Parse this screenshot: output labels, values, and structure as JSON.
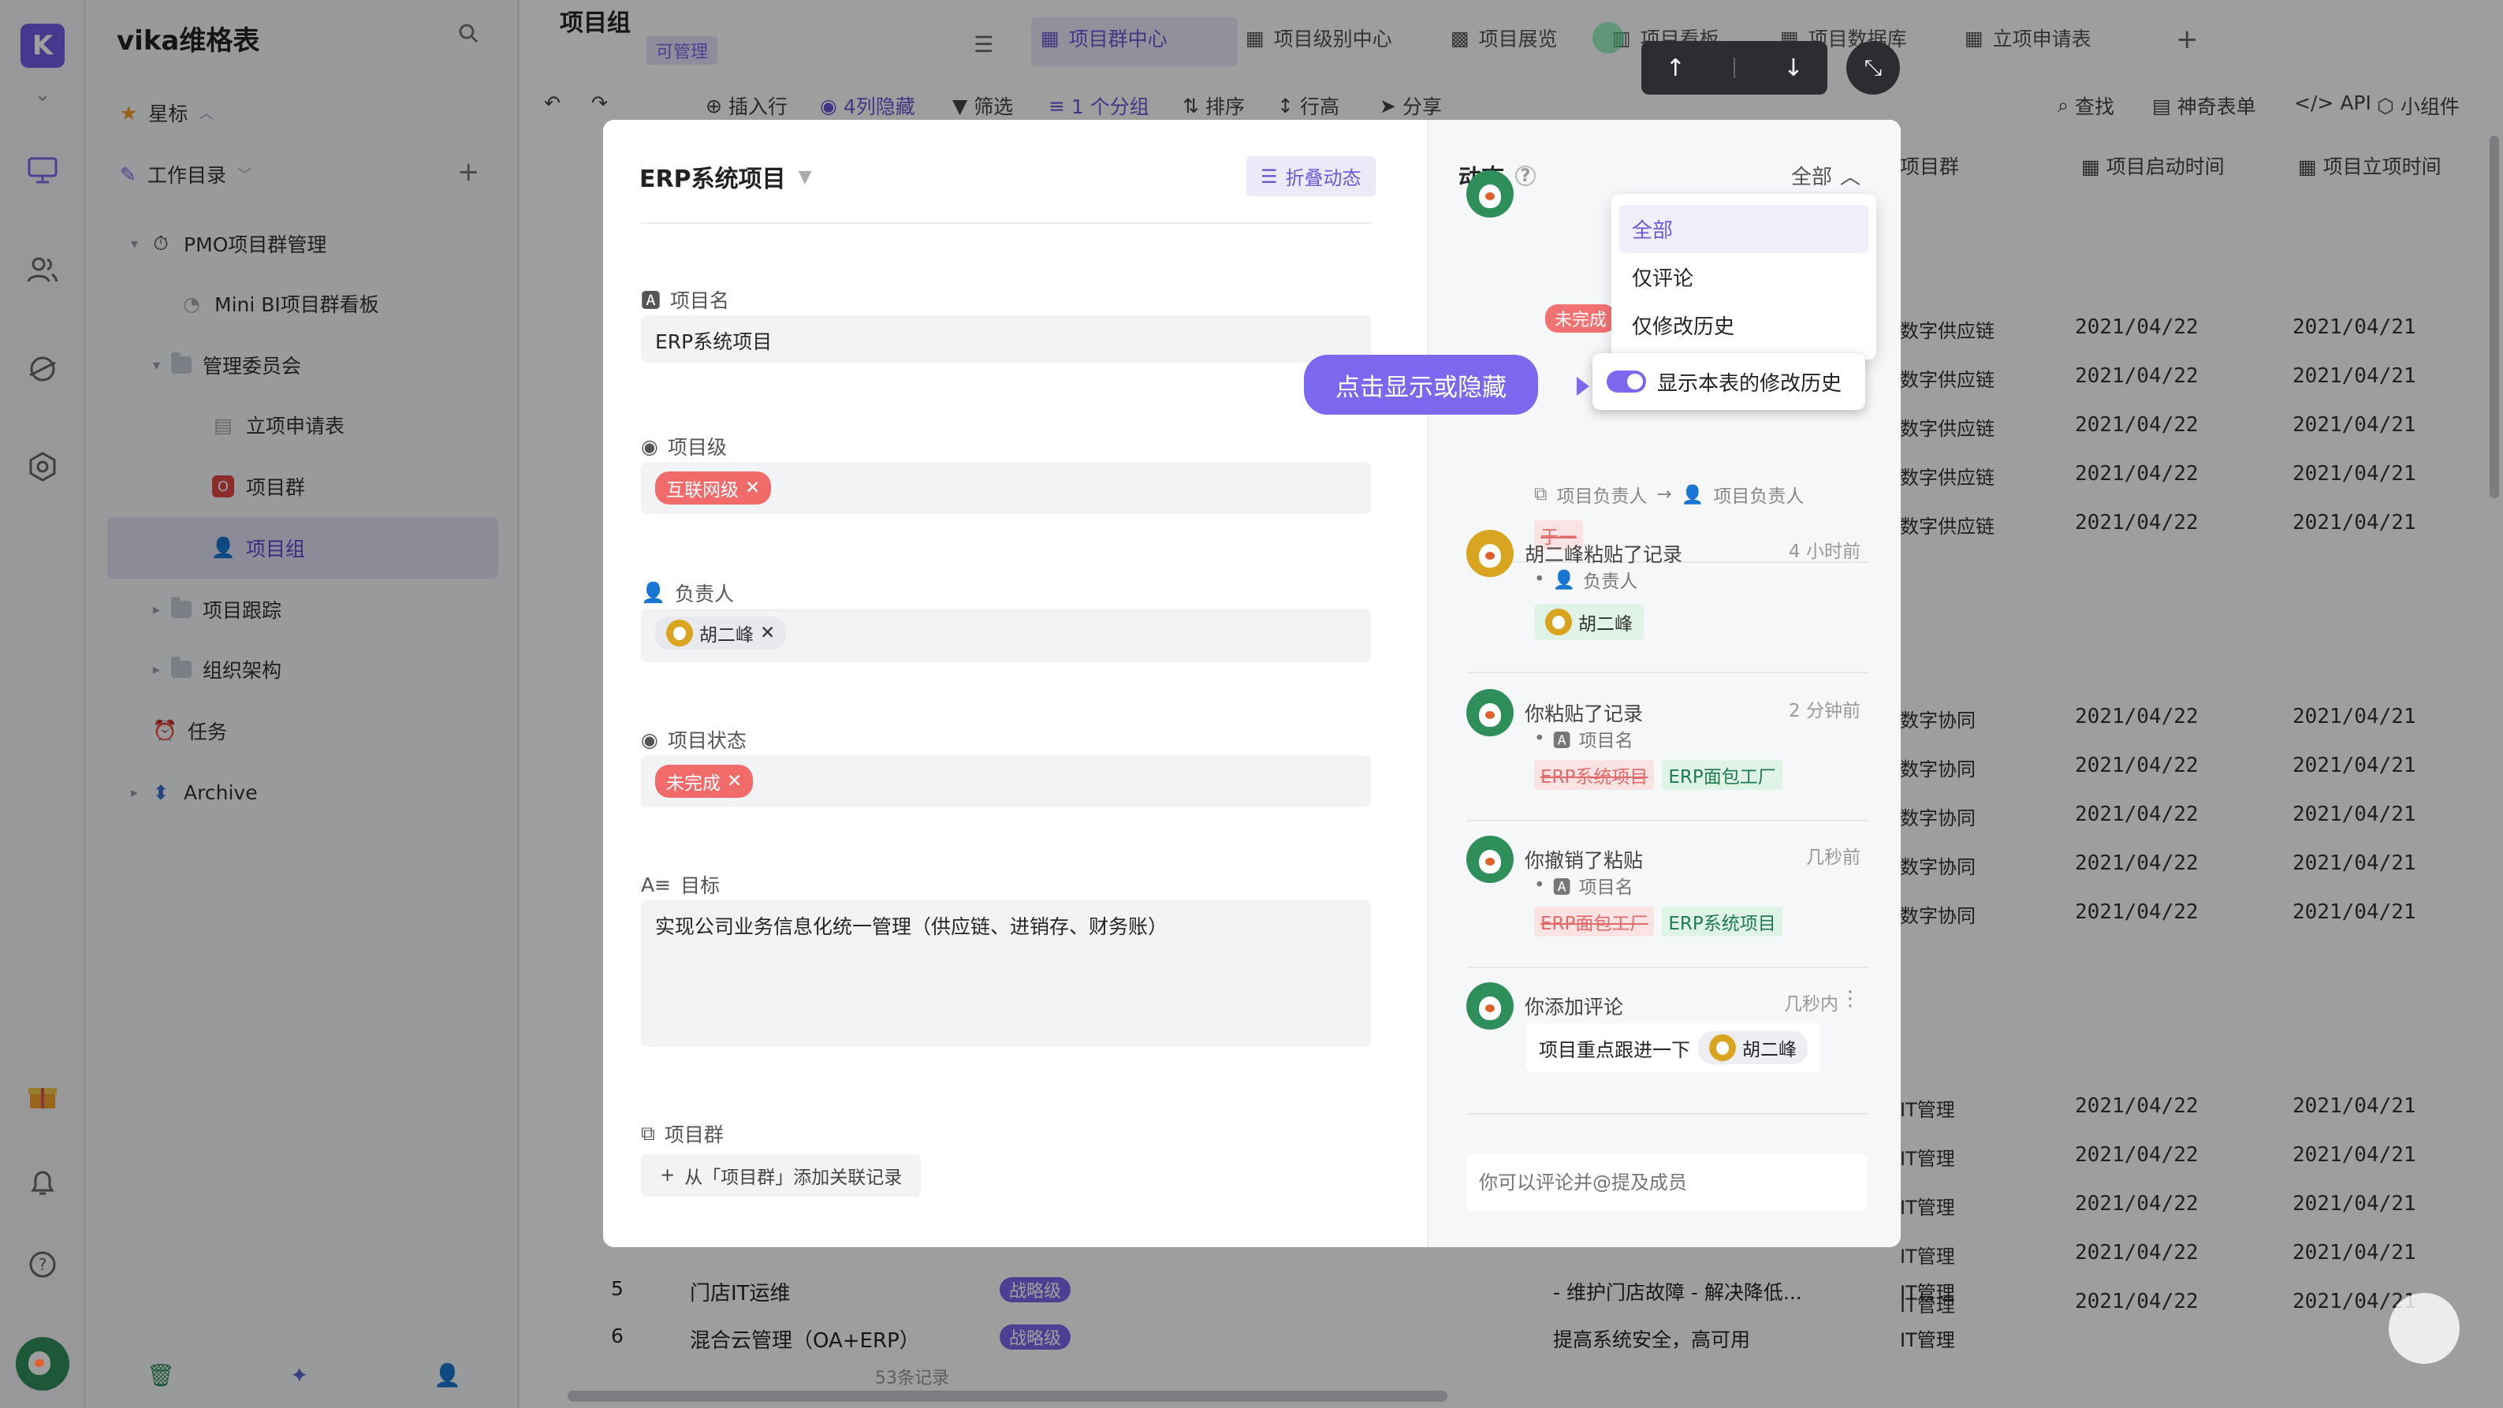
{
  "app": {
    "name": "vika维格表"
  },
  "sidebar": {
    "star_label": "星标",
    "workdir_label": "工作目录",
    "items": [
      {
        "label": "PMO项目群管理"
      },
      {
        "label": "Mini BI项目群看板"
      },
      {
        "label": "管理委员会"
      },
      {
        "label": "立项申请表"
      },
      {
        "label": "项目群"
      },
      {
        "label": "项目组"
      },
      {
        "label": "项目跟踪"
      },
      {
        "label": "组织架构"
      },
      {
        "label": "任务"
      },
      {
        "label": "Archive"
      }
    ]
  },
  "header": {
    "sheet_title": "项目组",
    "permission_badge": "可管理",
    "tabs": [
      {
        "label": "项目群中心"
      },
      {
        "label": "项目级别中心"
      },
      {
        "label": "项目展览"
      },
      {
        "label": "项目看板"
      },
      {
        "label": "项目数据库"
      },
      {
        "label": "立项申请表"
      }
    ]
  },
  "toolbar": {
    "insert_row": "插入行",
    "hidden_cols": "4列隐藏",
    "filter": "筛选",
    "group": "1 个分组",
    "sort": "排序",
    "row_height": "行高",
    "share": "分享",
    "find": "查找",
    "magic_form": "神奇表单",
    "api": "API",
    "widget": "小组件"
  },
  "grid": {
    "col_group": "项目群",
    "col_start": "项目启动时间",
    "col_create": "项目立项时间",
    "group_a": [
      "数字供应链",
      "数字供应链",
      "数字供应链",
      "数字供应链",
      "数字供应链"
    ],
    "group_b": [
      "数字协同",
      "数字协同",
      "数字协同",
      "数字协同",
      "数字协同"
    ],
    "group_c": [
      "IT管理",
      "IT管理",
      "IT管理",
      "IT管理",
      "IT管理"
    ],
    "date_start": "2021/04/22",
    "date_create": "2021/04/21",
    "row5": {
      "num": "5",
      "name": "门店IT运维",
      "level": "战略级",
      "desc": "- 维护门店故障 - 解决降低...",
      "group": "IT管理"
    },
    "row6": {
      "num": "6",
      "name": "混合云管理（OA+ERP）",
      "level": "战略级",
      "desc": "提高系统安全，高可用",
      "group": "IT管理"
    },
    "records_count": "53条记录"
  },
  "record": {
    "title": "ERP系统项目",
    "fold_activity": "折叠动态",
    "fields": {
      "name_label": "项目名",
      "name_value": "ERP系统项目",
      "level_label": "项目级",
      "level_value": "互联网级",
      "owner_label": "负责人",
      "owner_value": "胡二峰",
      "status_label": "项目状态",
      "status_value": "未完成",
      "goal_label": "目标",
      "goal_value": "实现公司业务信息化统一管理（供应链、进销存、财务账）",
      "group_label": "项目群",
      "group_add": "从「项目群」添加关联记录"
    }
  },
  "activity": {
    "title": "动态",
    "filter_selected": "全部",
    "filter_options": [
      "全部",
      "仅评论",
      "仅修改历史"
    ],
    "toggle_label": "显示本表的修改历史",
    "callout": "点击显示或隐藏",
    "partial": {
      "field": "项目负责人",
      "field_after": "项目负责人",
      "old": "于一",
      "tag": "未完成"
    },
    "items": [
      {
        "author": "胡二峰粘贴了记录",
        "time": "4 小时前",
        "field": "负责人",
        "value": "胡二峰"
      },
      {
        "author": "你粘贴了记录",
        "time": "2 分钟前",
        "field": "项目名",
        "old": "ERP系统项目",
        "new": "ERP面包工厂"
      },
      {
        "author": "你撤销了粘贴",
        "time": "几秒前",
        "field": "项目名",
        "old": "ERP面包工厂",
        "new": "ERP系统项目"
      },
      {
        "author": "你添加评论",
        "time": "几秒内",
        "comment": "项目重点跟进一下",
        "mention": "胡二峰"
      }
    ],
    "comment_placeholder": "你可以评论并@提及成员"
  }
}
